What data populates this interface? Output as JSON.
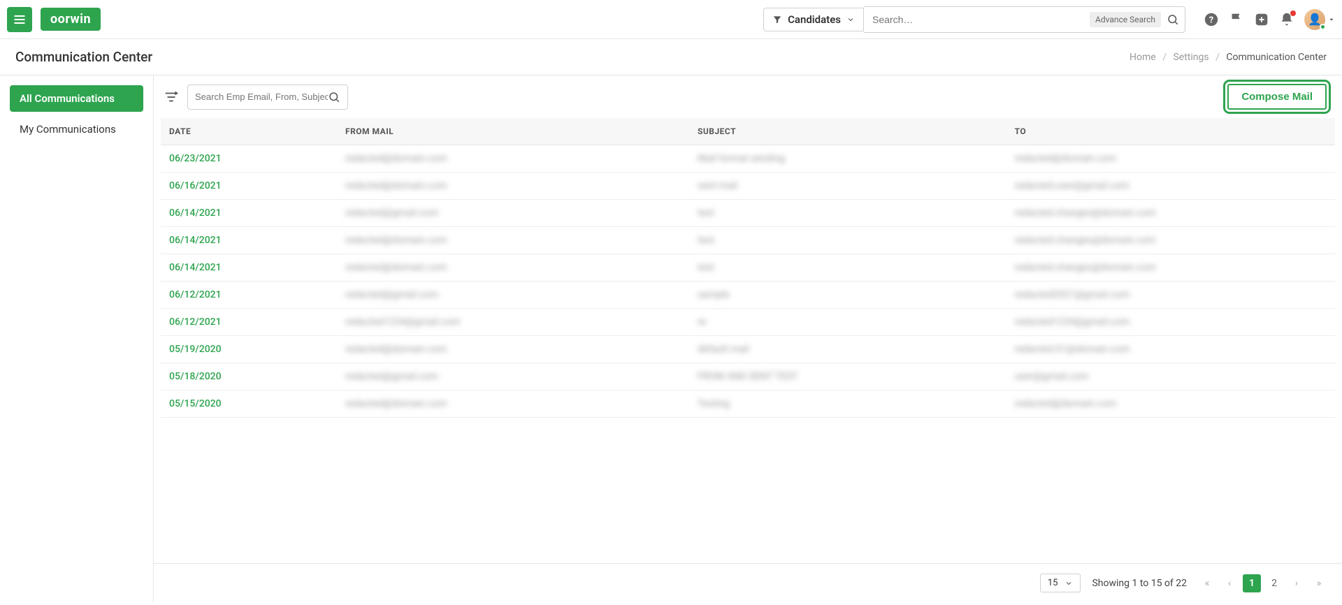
{
  "topbar": {
    "logo_text": "oorwin",
    "filter_label": "Candidates",
    "search_placeholder": "Search…",
    "adv_search_label": "Advance Search"
  },
  "subheader": {
    "title": "Communication Center",
    "breadcrumb": {
      "home": "Home",
      "settings": "Settings",
      "current": "Communication Center"
    }
  },
  "sidebar": {
    "items": [
      {
        "label": "All Communications",
        "active": true
      },
      {
        "label": "My Communications",
        "active": false
      }
    ]
  },
  "toolbar": {
    "emp_search_placeholder": "Search Emp Email, From, Subject",
    "compose_label": "Compose Mail"
  },
  "table": {
    "headers": {
      "date": "DATE",
      "from": "FROM MAIL",
      "subject": "SUBJECT",
      "to": "TO"
    },
    "rows": [
      {
        "date": "06/23/2021",
        "from": "redacted@domain.com",
        "subject": "Mail format sending",
        "to": "redacted@domain.com"
      },
      {
        "date": "06/16/2021",
        "from": "redacted@domain.com",
        "subject": "sent mail",
        "to": "redacted.user@gmail.com"
      },
      {
        "date": "06/14/2021",
        "from": "redacted@gmail.com",
        "subject": "test",
        "to": "redacted.changes@domain.com"
      },
      {
        "date": "06/14/2021",
        "from": "redacted@domain.com",
        "subject": "test",
        "to": "redacted.changes@domain.com"
      },
      {
        "date": "06/14/2021",
        "from": "redacted@domain.com",
        "subject": "test",
        "to": "redacted.changes@domain.com"
      },
      {
        "date": "06/12/2021",
        "from": "redacted@gmail.com",
        "subject": "sample",
        "to": "redacted2021@gmail.com"
      },
      {
        "date": "06/12/2021",
        "from": "redacted1234@gmail.com",
        "subject": "re",
        "to": "redacted1234@gmail.com"
      },
      {
        "date": "05/19/2020",
        "from": "redacted@domain.com",
        "subject": "default mail",
        "to": "redacted.01@domain.com"
      },
      {
        "date": "05/18/2020",
        "from": "redacted@gmail.com",
        "subject": "FROM AND SENT TEST",
        "to": "user@gmail.com"
      },
      {
        "date": "05/15/2020",
        "from": "redacted@domain.com",
        "subject": "Testing",
        "to": "redacted@domain.com"
      }
    ]
  },
  "footer": {
    "page_size": "15",
    "showing": "Showing 1 to 15 of 22",
    "pages": [
      "1",
      "2"
    ],
    "active_page": "1"
  }
}
